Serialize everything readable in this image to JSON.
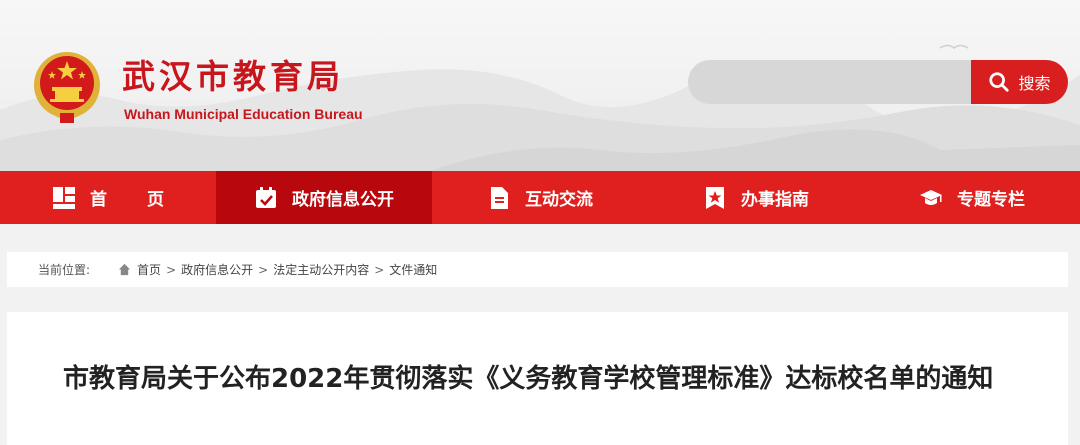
{
  "header": {
    "title": "武汉市教育局",
    "subtitle": "Wuhan Municipal Education Bureau",
    "logo_icon": "national-emblem-icon",
    "search": {
      "placeholder": "",
      "button_label": "搜索",
      "icon": "search-icon"
    }
  },
  "nav": {
    "items": [
      {
        "label": "首页",
        "icon": "home-grid-icon",
        "active": false
      },
      {
        "label": "政府信息公开",
        "icon": "calendar-check-icon",
        "active": true
      },
      {
        "label": "互动交流",
        "icon": "document-icon",
        "active": false
      },
      {
        "label": "办事指南",
        "icon": "star-badge-icon",
        "active": false
      },
      {
        "label": "专题专栏",
        "icon": "graduation-cap-icon",
        "active": false
      }
    ]
  },
  "breadcrumb": {
    "label": "当前位置:",
    "items": [
      "首页",
      "政府信息公开",
      "法定主动公开内容",
      "文件通知"
    ],
    "separator": ">"
  },
  "article": {
    "title": "市教育局关于公布2022年贯彻落实《义务教育学校管理标准》达标校名单的通知"
  },
  "colors": {
    "brand_red": "#c8161d",
    "nav_red": "#e01f1f",
    "nav_active": "#b8080e",
    "search_button": "#d81e1e"
  }
}
